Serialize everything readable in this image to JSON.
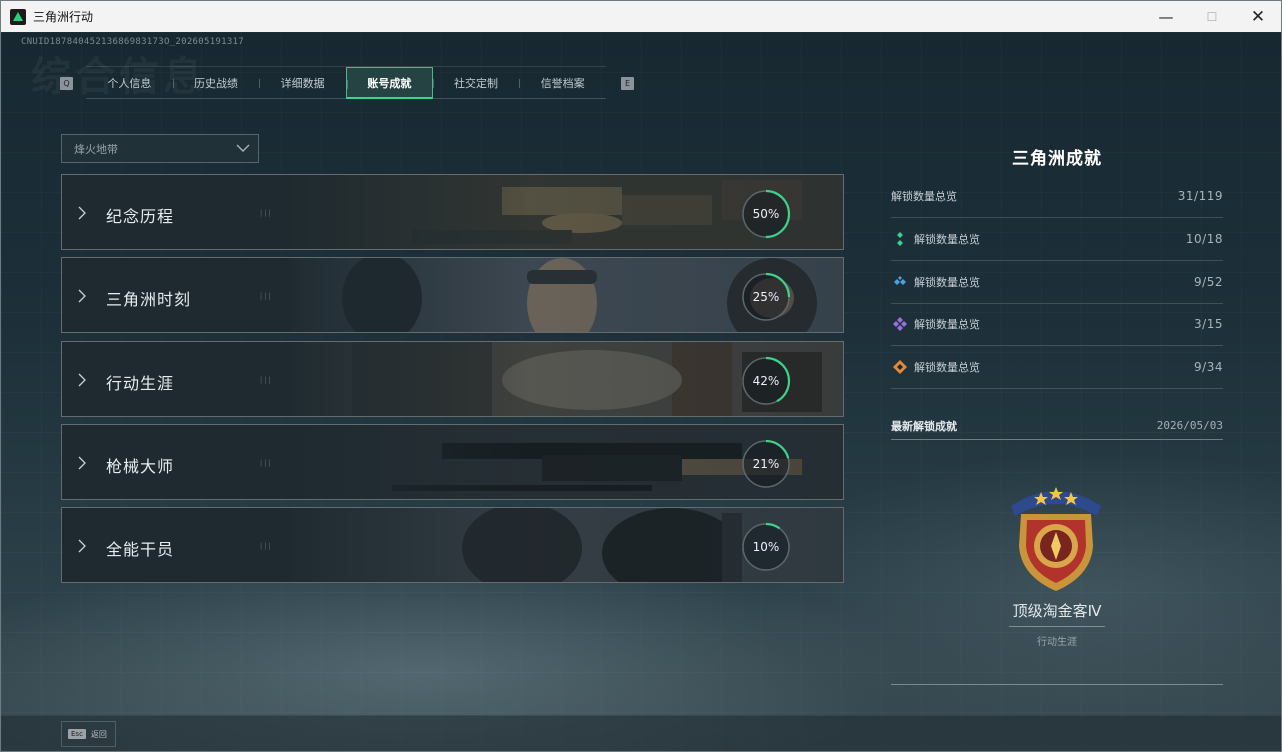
{
  "window": {
    "title": "三角洲行动",
    "min": "—",
    "max": "☐",
    "close": "✕"
  },
  "uid": "CNUID18784045213686983173O_202605191317",
  "bg_heading": "综合信息",
  "tabs": [
    {
      "label": "个人信息"
    },
    {
      "label": "历史战绩"
    },
    {
      "label": "详细数据"
    },
    {
      "label": "账号成就"
    },
    {
      "label": "社交定制"
    },
    {
      "label": "信誉档案"
    }
  ],
  "active_tab": 3,
  "tab_keys": {
    "prev": "Q",
    "next": "E"
  },
  "dropdown": {
    "value": "烽火地带"
  },
  "cards": [
    {
      "label": "纪念历程",
      "percent": 50,
      "percent_text": "50%",
      "tick": "|||"
    },
    {
      "label": "三角洲时刻",
      "percent": 25,
      "percent_text": "25%",
      "tick": "|||"
    },
    {
      "label": "行动生涯",
      "percent": 42,
      "percent_text": "42%",
      "tick": "|||"
    },
    {
      "label": "枪械大师",
      "percent": 21,
      "percent_text": "21%",
      "tick": "|||"
    },
    {
      "label": "全能干员",
      "percent": 10,
      "percent_text": "10%",
      "tick": "|||"
    }
  ],
  "panel": {
    "title": "三角洲成就",
    "summary": [
      {
        "label": "解锁数量总览",
        "value": "31/119",
        "icon": "none",
        "color": ""
      },
      {
        "label": "解锁数量总览",
        "value": "10/18",
        "icon": "green-diamond-icon",
        "color": "#3ad18c"
      },
      {
        "label": "解锁数量总览",
        "value": "9/52",
        "icon": "blue-diamond-icon",
        "color": "#4aa3e0"
      },
      {
        "label": "解锁数量总览",
        "value": "3/15",
        "icon": "purple-diamond-icon",
        "color": "#9b6ee0"
      },
      {
        "label": "解锁数量总览",
        "value": "9/34",
        "icon": "orange-diamond-icon",
        "color": "#e08a3a"
      }
    ],
    "latest_label": "最新解锁成就",
    "latest_date": "2026/05/03",
    "badge_name": "顶级淘金客Ⅳ",
    "badge_category": "行动生涯"
  },
  "footer": {
    "esc_key": "Esc",
    "esc_label": "返回"
  },
  "colors": {
    "accent": "#3fd08a",
    "ring_track": "#5d666b"
  }
}
